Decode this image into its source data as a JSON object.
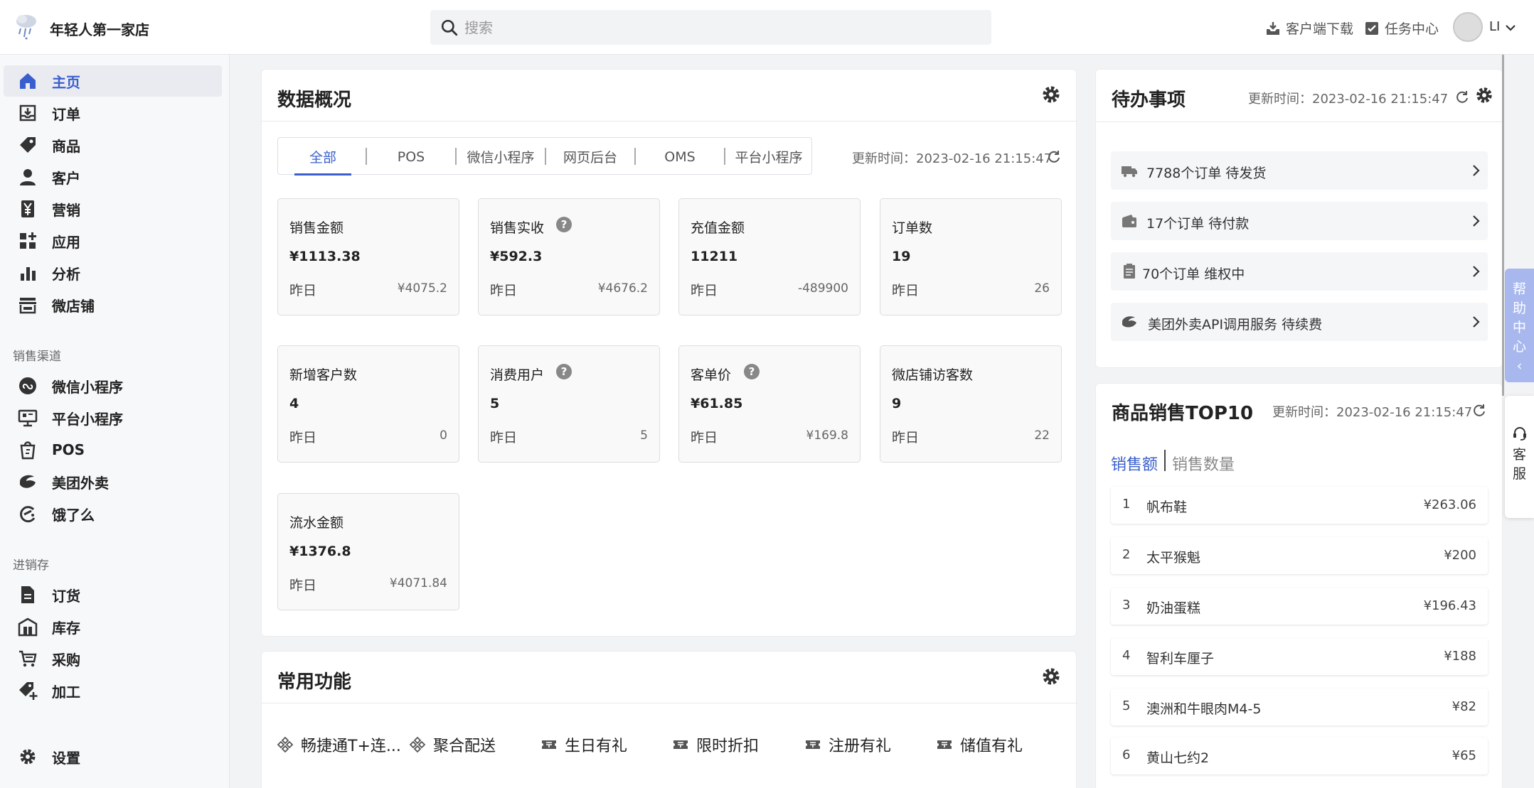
{
  "header": {
    "store_name": "年轻人第一家店",
    "search_placeholder": "搜索",
    "download_label": "客户端下载",
    "tasks_label": "任务中心",
    "user_name": "LI"
  },
  "sidebar": {
    "main_items": [
      {
        "label": "主页",
        "icon": "home-icon"
      },
      {
        "label": "订单",
        "icon": "order-icon"
      },
      {
        "label": "商品",
        "icon": "tag-icon"
      },
      {
        "label": "客户",
        "icon": "user-icon"
      },
      {
        "label": "营销",
        "icon": "yen-icon"
      },
      {
        "label": "应用",
        "icon": "apps-icon"
      },
      {
        "label": "分析",
        "icon": "bar-chart-icon"
      },
      {
        "label": "微店铺",
        "icon": "store-icon"
      }
    ],
    "section_sales": "销售渠道",
    "sales_items": [
      {
        "label": "微信小程序",
        "icon": "mini-program-icon"
      },
      {
        "label": "平台小程序",
        "icon": "platform-icon"
      },
      {
        "label": "POS",
        "icon": "pos-icon"
      },
      {
        "label": "美团外卖",
        "icon": "meituan-icon"
      },
      {
        "label": "饿了么",
        "icon": "eleme-icon"
      }
    ],
    "section_inventory": "进销存",
    "inventory_items": [
      {
        "label": "订货",
        "icon": "document-icon"
      },
      {
        "label": "库存",
        "icon": "warehouse-icon"
      },
      {
        "label": "采购",
        "icon": "cart-icon"
      },
      {
        "label": "加工",
        "icon": "tag-plus-icon"
      }
    ],
    "settings_label": "设置"
  },
  "overview": {
    "title": "数据概况",
    "tabs": [
      "全部",
      "POS",
      "微信小程序",
      "网页后台",
      "OMS",
      "平台小程序"
    ],
    "update_time": "更新时间：2023-02-16 21:15:47",
    "metrics": [
      {
        "label": "销售金额",
        "value": "¥1113.38",
        "yesterday_label": "昨日",
        "yesterday_value": "¥4075.2",
        "help": false
      },
      {
        "label": "销售实收",
        "value": "¥592.3",
        "yesterday_label": "昨日",
        "yesterday_value": "¥4676.2",
        "help": true
      },
      {
        "label": "充值金额",
        "value": "11211",
        "yesterday_label": "昨日",
        "yesterday_value": "-489900",
        "help": false
      },
      {
        "label": "订单数",
        "value": "19",
        "yesterday_label": "昨日",
        "yesterday_value": "26",
        "help": false
      },
      {
        "label": "新增客户数",
        "value": "4",
        "yesterday_label": "昨日",
        "yesterday_value": "0",
        "help": false
      },
      {
        "label": "消费用户",
        "value": "5",
        "yesterday_label": "昨日",
        "yesterday_value": "5",
        "help": true
      },
      {
        "label": "客单价",
        "value": "¥61.85",
        "yesterday_label": "昨日",
        "yesterday_value": "¥169.8",
        "help": true
      },
      {
        "label": "微店铺访客数",
        "value": "9",
        "yesterday_label": "昨日",
        "yesterday_value": "22",
        "help": false
      },
      {
        "label": "流水金额",
        "value": "¥1376.8",
        "yesterday_label": "昨日",
        "yesterday_value": "¥4071.84",
        "help": false
      }
    ]
  },
  "todo": {
    "title": "待办事项",
    "update_time": "更新时间：2023-02-16 21:15:47",
    "items": [
      {
        "text": "7788个订单 待发货",
        "icon": "truck-icon"
      },
      {
        "text": "17个订单 待付款",
        "icon": "wallet-icon"
      },
      {
        "text": "70个订单 维权中",
        "icon": "clipboard-icon"
      },
      {
        "text": "美团外卖API调用服务 待续费",
        "icon": "meituan-icon"
      }
    ]
  },
  "top10": {
    "title": "商品销售TOP10",
    "update_time": "更新时间：2023-02-16 21:15:47",
    "tab_amount": "销售额",
    "tab_quantity": "销售数量",
    "items": [
      {
        "rank": "1",
        "name": "帆布鞋",
        "value": "¥263.06"
      },
      {
        "rank": "2",
        "name": "太平猴魁",
        "value": "¥200"
      },
      {
        "rank": "3",
        "name": "奶油蛋糕",
        "value": "¥196.43"
      },
      {
        "rank": "4",
        "name": "智利车厘子",
        "value": "¥188"
      },
      {
        "rank": "5",
        "name": "澳洲和牛眼肉M4-5",
        "value": "¥82"
      },
      {
        "rank": "6",
        "name": "黄山七约2",
        "value": "¥65"
      }
    ]
  },
  "functions": {
    "title": "常用功能",
    "items": [
      {
        "label": "畅捷通T+连...",
        "icon": "diamond-icon"
      },
      {
        "label": "聚合配送",
        "icon": "diamond-icon"
      },
      {
        "label": "生日有礼",
        "icon": "ticket-icon"
      },
      {
        "label": "限时折扣",
        "icon": "ticket-icon"
      },
      {
        "label": "注册有礼",
        "icon": "ticket-icon"
      },
      {
        "label": "储值有礼",
        "icon": "ticket-icon"
      }
    ]
  },
  "floating": {
    "help_center": "帮助中心",
    "help_arrow": "‹",
    "service": "客服"
  },
  "colors": {
    "accent": "#3a5fcd",
    "help_tab": "#a8b8ef"
  }
}
